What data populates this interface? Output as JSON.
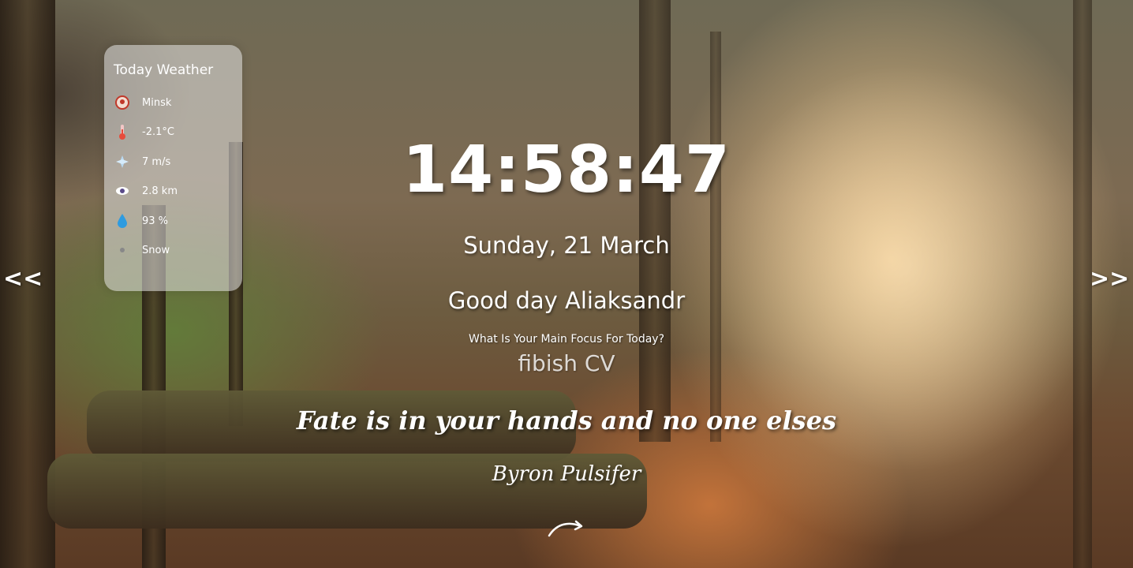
{
  "weather": {
    "title": "Today Weather",
    "rows": [
      {
        "icon": "city-icon",
        "text": "Minsk"
      },
      {
        "icon": "thermometer-icon",
        "text": "-2.1°C"
      },
      {
        "icon": "wind-icon",
        "text": "7 m/s"
      },
      {
        "icon": "visibility-icon",
        "text": "2.8 km"
      },
      {
        "icon": "humidity-icon",
        "text": "93 %"
      },
      {
        "icon": "snow-icon",
        "text": "Snow"
      }
    ]
  },
  "clock": {
    "time": "14:58:47"
  },
  "date": {
    "text": "Sunday, 21 March"
  },
  "greeting": {
    "prefix": "Good day",
    "name": "Aliaksandr"
  },
  "focus": {
    "question": "What Is Your Main Focus For Today?",
    "value": "fibish CV"
  },
  "quote": {
    "text": "Fate is in your hands and no one elses",
    "author": "Byron Pulsifer"
  },
  "nav": {
    "prev_label": "<<",
    "next_label": ">>"
  },
  "icons": {
    "refresh": "refresh-arrow-icon"
  }
}
